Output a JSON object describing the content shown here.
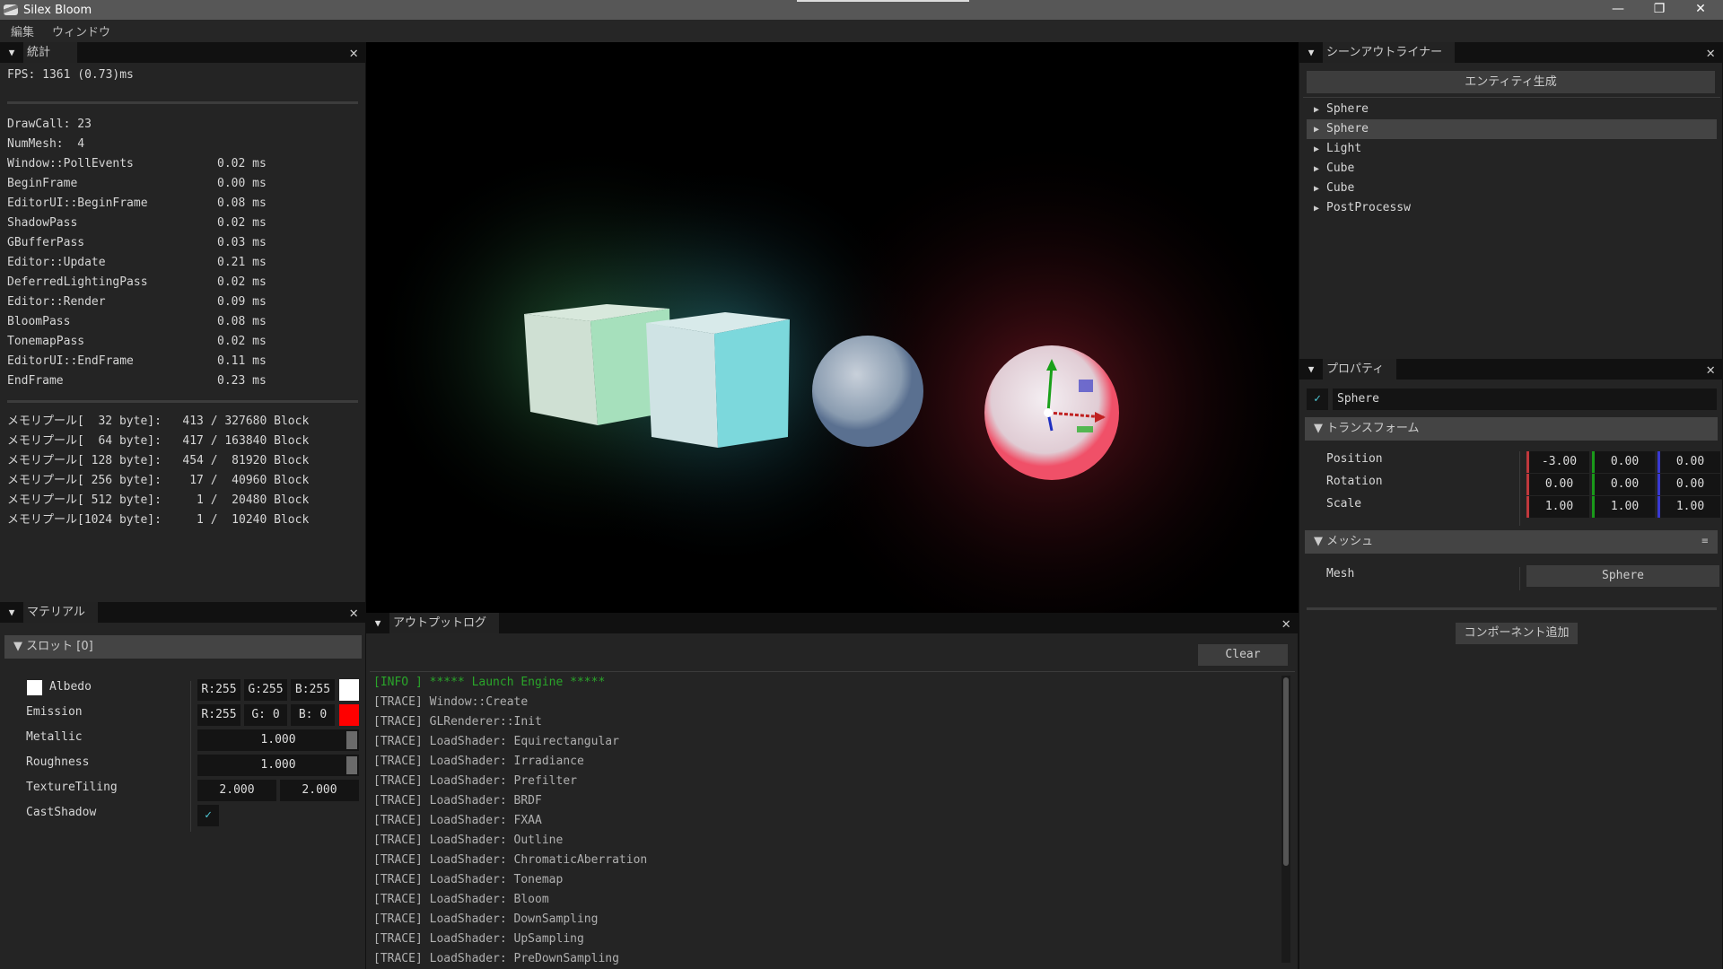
{
  "window": {
    "title": "Silex  Bloom",
    "minimize": "—",
    "maximize": "❐",
    "close": "✕"
  },
  "menu": [
    "編集",
    "ウィンドウ"
  ],
  "stats": {
    "tab": "統計",
    "fps": "FPS: 1361 (0.73)ms",
    "drawcall": "DrawCall: 23",
    "nummesh": "NumMesh:  4",
    "timings": [
      [
        "Window::PollEvents",
        "0.02 ms"
      ],
      [
        "BeginFrame",
        "0.00 ms"
      ],
      [
        "EditorUI::BeginFrame",
        "0.08 ms"
      ],
      [
        "ShadowPass",
        "0.02 ms"
      ],
      [
        "GBufferPass",
        "0.03 ms"
      ],
      [
        "Editor::Update",
        "0.21 ms"
      ],
      [
        "DeferredLightingPass",
        "0.02 ms"
      ],
      [
        "Editor::Render",
        "0.09 ms"
      ],
      [
        "BloomPass",
        "0.08 ms"
      ],
      [
        "TonemapPass",
        "0.02 ms"
      ],
      [
        "EditorUI::EndFrame",
        "0.11 ms"
      ],
      [
        "EndFrame",
        "0.23 ms"
      ]
    ],
    "memory": [
      "メモリプール[  32 byte]:   413 / 327680 Block",
      "メモリプール[  64 byte]:   417 / 163840 Block",
      "メモリプール[ 128 byte]:   454 /  81920 Block",
      "メモリプール[ 256 byte]:    17 /  40960 Block",
      "メモリプール[ 512 byte]:     1 /  20480 Block",
      "メモリプール[1024 byte]:     1 /  10240 Block"
    ]
  },
  "material": {
    "tab": "マテリアル",
    "slot": "スロット [0]",
    "albedo": {
      "label": "Albedo",
      "r": "R:255",
      "g": "G:255",
      "b": "B:255",
      "color": "#ffffff"
    },
    "emission": {
      "label": "Emission",
      "r": "R:255",
      "g": "G:  0",
      "b": "B:  0",
      "color": "#ff0000"
    },
    "metallic": {
      "label": "Metallic",
      "value": "1.000"
    },
    "roughness": {
      "label": "Roughness",
      "value": "1.000"
    },
    "tiling": {
      "label": "TextureTiling",
      "x": "2.000",
      "y": "2.000"
    },
    "castshadow": {
      "label": "CastShadow",
      "checked": true
    }
  },
  "log": {
    "tab": "アウトプットログ",
    "clear": "Clear",
    "lines": [
      [
        "info",
        "[INFO ] ***** Launch Engine *****"
      ],
      [
        "trace",
        "[TRACE] Window::Create"
      ],
      [
        "trace",
        "[TRACE] GLRenderer::Init"
      ],
      [
        "trace",
        "[TRACE] LoadShader: Equirectangular"
      ],
      [
        "trace",
        "[TRACE] LoadShader: Irradiance"
      ],
      [
        "trace",
        "[TRACE] LoadShader: Prefilter"
      ],
      [
        "trace",
        "[TRACE] LoadShader: BRDF"
      ],
      [
        "trace",
        "[TRACE] LoadShader: FXAA"
      ],
      [
        "trace",
        "[TRACE] LoadShader: Outline"
      ],
      [
        "trace",
        "[TRACE] LoadShader: ChromaticAberration"
      ],
      [
        "trace",
        "[TRACE] LoadShader: Tonemap"
      ],
      [
        "trace",
        "[TRACE] LoadShader: Bloom"
      ],
      [
        "trace",
        "[TRACE] LoadShader: DownSampling"
      ],
      [
        "trace",
        "[TRACE] LoadShader: UpSampling"
      ],
      [
        "trace",
        "[TRACE] LoadShader: PreDownSampling"
      ]
    ]
  },
  "outliner": {
    "tab": "シーンアウトライナー",
    "create": "エンティティ生成",
    "items": [
      "Sphere",
      "Sphere",
      "Light",
      "Cube",
      "Cube",
      "PostProcessw"
    ],
    "selected": 1
  },
  "properties": {
    "tab": "プロパティ",
    "name": "Sphere",
    "transform": "トランスフォーム",
    "position": {
      "label": "Position",
      "values": [
        "-3.00",
        "0.00",
        "0.00"
      ]
    },
    "rotation": {
      "label": "Rotation",
      "values": [
        "0.00",
        "0.00",
        "0.00"
      ]
    },
    "scale": {
      "label": "Scale",
      "values": [
        "1.00",
        "1.00",
        "1.00"
      ]
    },
    "mesh_header": "メッシュ",
    "mesh_label": "Mesh",
    "mesh_value": "Sphere",
    "add_component": "コンポーネント追加"
  },
  "colors": {
    "info": "#2aa52a",
    "trace": "#b0b0b0",
    "x": "#c0383c",
    "y": "#1a9a1a",
    "z": "#3838d0",
    "check": "#4fc9d6"
  }
}
